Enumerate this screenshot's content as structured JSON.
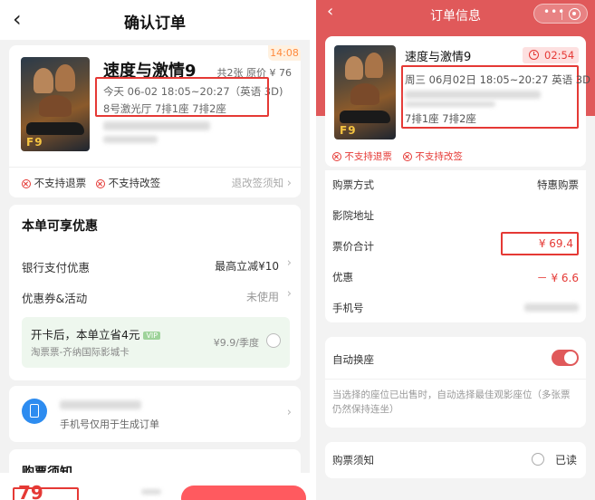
{
  "left": {
    "header": {
      "title": "确认订单",
      "back_icon": "chevron-left-icon"
    },
    "timer": "14:08",
    "movie": {
      "title": "速度与激情9",
      "count_price": "共2张 原价 ¥ 76",
      "showtime": "今天 06-02 18:05~20:27（英语 3D)",
      "seats": "8号激光厅 7排1座 7排2座"
    },
    "policies": {
      "no_refund": "不支持退票",
      "no_change": "不支持改签",
      "notice_link": "退改签须知"
    },
    "discounts": {
      "heading": "本单可享优惠",
      "bank_label": "银行支付优惠",
      "bank_value": "最高立减¥10",
      "coupon_label": "优惠券&活动",
      "coupon_value": "未使用",
      "promo_title": "开卡后，本单立省4元",
      "promo_badge": "VIP",
      "promo_sub": "淘票票-齐纳国际影城卡",
      "promo_price": "¥9.9/季度"
    },
    "phone": {
      "note": "手机号仅用于生成订单"
    },
    "notice": {
      "heading": "购票须知"
    },
    "footer": {
      "price": "79"
    }
  },
  "right": {
    "header": {
      "title": "订单信息"
    },
    "timer": "02:54",
    "movie": {
      "title": "速度与激情9",
      "showtime": "周三 06月02日 18:05~20:27 英语 3D",
      "seats": "7排1座 7排2座"
    },
    "policies": {
      "no_refund": "不支持退票",
      "no_change": "不支持改签"
    },
    "rows": {
      "purchase_method_label": "购票方式",
      "purchase_method_value": "特惠购票",
      "cinema_address_label": "影院地址",
      "total_label": "票价合计",
      "total_value": "¥ 69.4",
      "discount_label": "优惠",
      "discount_value": "－ ¥ 6.6",
      "phone_label": "手机号"
    },
    "auto_seat": {
      "label": "自动换座",
      "desc": "当选择的座位已出售时，自动选择最佳观影座位（多张票仍然保持连坐）"
    },
    "notice": {
      "label": "购票须知",
      "read": "已读"
    }
  },
  "colors": {
    "accent_red": "#e53935",
    "header_red": "#e0595a",
    "promo_green": "#eef7ee",
    "timer_orange": "#ff8a3d"
  }
}
